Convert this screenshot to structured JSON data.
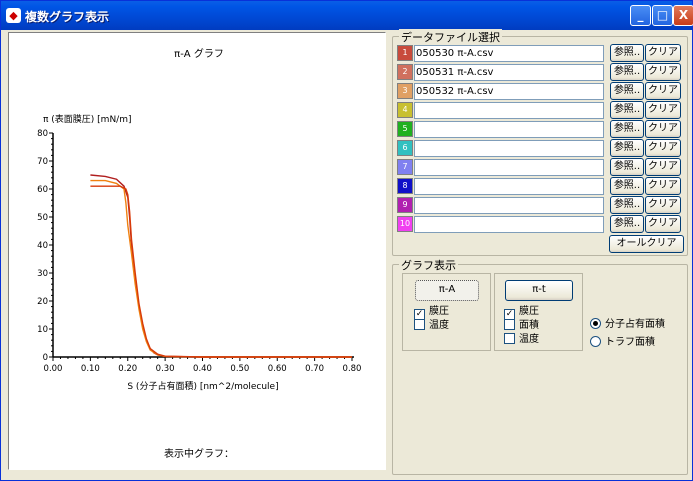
{
  "window": {
    "title": "複数グラフ表示",
    "buttons": {
      "minimize": "_",
      "maximize": "□",
      "close": "X"
    }
  },
  "graph": {
    "footer_label": "表示中グラフ：",
    "chart_data": {
      "type": "line",
      "title": "π-A グラフ",
      "ylabel": "π (表面膜圧) [mN/m]",
      "xlabel": "S (分子占有面積) [nm^2/molecule]",
      "xlim": [
        0.0,
        0.8
      ],
      "ylim": [
        0,
        80
      ],
      "x_ticks": [
        "0.00",
        "0.10",
        "0.20",
        "0.30",
        "0.40",
        "0.50",
        "0.60",
        "0.70",
        "0.80"
      ],
      "y_ticks": [
        "0",
        "10",
        "20",
        "30",
        "40",
        "50",
        "60",
        "70",
        "80"
      ],
      "grid": false,
      "series": [
        {
          "color": "#b01e1e",
          "x": [
            0.1,
            0.14,
            0.17,
            0.19,
            0.2,
            0.205,
            0.21,
            0.22,
            0.23,
            0.24,
            0.25,
            0.26,
            0.27,
            0.28,
            0.3,
            0.4,
            0.8
          ],
          "y": [
            65,
            64.5,
            63.5,
            61,
            57,
            50,
            40,
            28,
            18,
            11,
            6,
            3,
            1.5,
            0.7,
            0.2,
            0,
            0
          ]
        },
        {
          "color": "#f08010",
          "x": [
            0.1,
            0.14,
            0.17,
            0.19,
            0.195,
            0.2,
            0.21,
            0.22,
            0.23,
            0.24,
            0.25,
            0.26,
            0.28,
            0.3,
            0.4,
            0.8
          ],
          "y": [
            63,
            63,
            62,
            60,
            55,
            47,
            37,
            26,
            17,
            10,
            5.5,
            2.5,
            0.8,
            0.2,
            0,
            0
          ]
        },
        {
          "color": "#d83a0a",
          "x": [
            0.1,
            0.15,
            0.18,
            0.195,
            0.2,
            0.205,
            0.21,
            0.22,
            0.23,
            0.24,
            0.25,
            0.26,
            0.28,
            0.3,
            0.4,
            0.8
          ],
          "y": [
            61,
            61,
            61,
            60,
            58,
            52,
            42,
            30,
            19,
            12,
            6.5,
            3,
            1,
            0.3,
            0,
            0
          ]
        }
      ]
    }
  },
  "files": {
    "group_label": "データファイル選択",
    "browse_label": "参照..",
    "clear_label": "クリア",
    "all_clear_label": "オールクリア",
    "rows": [
      {
        "swatch_color": "#c84b3c",
        "index": "1",
        "filename": "050530 π-A.csv"
      },
      {
        "swatch_color": "#d0705e",
        "index": "2",
        "filename": "050531 π-A.csv"
      },
      {
        "swatch_color": "#e0a064",
        "index": "3",
        "filename": "050532 π-A.csv"
      },
      {
        "swatch_color": "#c8c030",
        "index": "4",
        "filename": ""
      },
      {
        "swatch_color": "#20b020",
        "index": "5",
        "filename": ""
      },
      {
        "swatch_color": "#30c0c0",
        "index": "6",
        "filename": ""
      },
      {
        "swatch_color": "#8080f0",
        "index": "7",
        "filename": ""
      },
      {
        "swatch_color": "#1010c8",
        "index": "8",
        "filename": ""
      },
      {
        "swatch_color": "#b020b0",
        "index": "9",
        "filename": ""
      },
      {
        "swatch_color": "#f040f0",
        "index": "10",
        "filename": ""
      }
    ]
  },
  "graph_display": {
    "group_label": "グラフ表示",
    "pi_a": {
      "button": "π-A",
      "checks": [
        {
          "label": "膜圧",
          "checked": true
        },
        {
          "label": "温度",
          "checked": false
        }
      ]
    },
    "pi_t": {
      "button": "π-t",
      "checks": [
        {
          "label": "膜圧",
          "checked": true
        },
        {
          "label": "面積",
          "checked": false
        },
        {
          "label": "温度",
          "checked": false
        }
      ]
    },
    "radios": [
      {
        "label": "分子占有面積",
        "selected": true
      },
      {
        "label": "トラフ面積",
        "selected": false
      }
    ]
  }
}
